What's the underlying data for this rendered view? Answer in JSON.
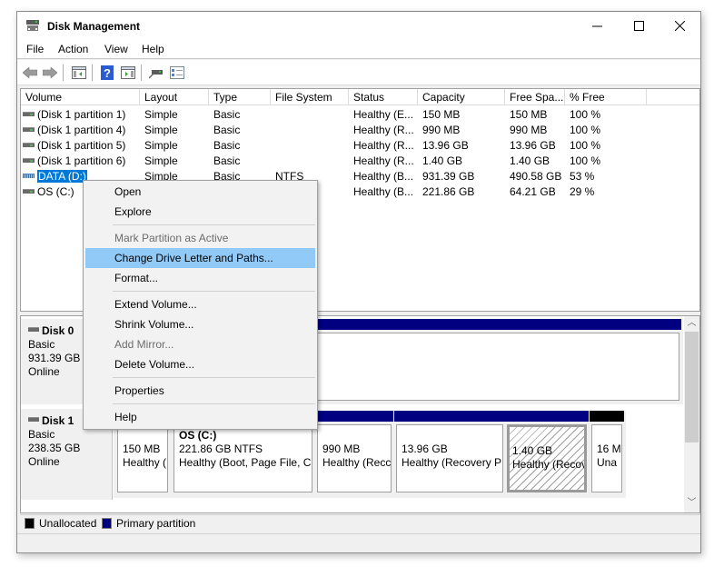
{
  "window": {
    "title": "Disk Management",
    "controls": {
      "minimize": "—",
      "maximize": "☐",
      "close": "✕"
    }
  },
  "menu": [
    "File",
    "Action",
    "View",
    "Help"
  ],
  "toolbar": {
    "buttons": [
      "back-arrow-icon",
      "forward-arrow-icon",
      "show-hide-console-tree-icon",
      "help-icon",
      "show-hide-action-pane-icon",
      "connect-disk-icon",
      "properties-checklist-icon"
    ]
  },
  "volume_list": {
    "columns": [
      "Volume",
      "Layout",
      "Type",
      "File System",
      "Status",
      "Capacity",
      "Free Spa...",
      "% Free"
    ],
    "rows": [
      {
        "volume": "(Disk 1 partition 1)",
        "layout": "Simple",
        "type": "Basic",
        "fs": "",
        "status": "Healthy (E...",
        "capacity": "150 MB",
        "free": "150 MB",
        "pct": "100 %"
      },
      {
        "volume": "(Disk 1 partition 4)",
        "layout": "Simple",
        "type": "Basic",
        "fs": "",
        "status": "Healthy (R...",
        "capacity": "990 MB",
        "free": "990 MB",
        "pct": "100 %"
      },
      {
        "volume": "(Disk 1 partition 5)",
        "layout": "Simple",
        "type": "Basic",
        "fs": "",
        "status": "Healthy (R...",
        "capacity": "13.96 GB",
        "free": "13.96 GB",
        "pct": "100 %"
      },
      {
        "volume": "(Disk 1 partition 6)",
        "layout": "Simple",
        "type": "Basic",
        "fs": "",
        "status": "Healthy (R...",
        "capacity": "1.40 GB",
        "free": "1.40 GB",
        "pct": "100 %"
      },
      {
        "volume": "DATA (D:)",
        "layout": "Simple",
        "type": "Basic",
        "fs": "NTFS",
        "status": "Healthy (B...",
        "capacity": "931.39 GB",
        "free": "490.58 GB",
        "pct": "53 %"
      },
      {
        "volume": "OS (C:)",
        "layout": "",
        "type": "",
        "fs": "",
        "status": "Healthy (B...",
        "capacity": "221.86 GB",
        "free": "64.21 GB",
        "pct": "29 %"
      }
    ],
    "selected_row": 4
  },
  "context_menu": {
    "items": [
      {
        "label": "Open",
        "enabled": true
      },
      {
        "label": "Explore",
        "enabled": true
      },
      {
        "label": "Mark Partition as Active",
        "enabled": false
      },
      {
        "label": "Change Drive Letter and Paths...",
        "enabled": true,
        "highlighted": true
      },
      {
        "label": "Format...",
        "enabled": true
      },
      {
        "label": "Extend Volume...",
        "enabled": true
      },
      {
        "label": "Shrink Volume...",
        "enabled": true
      },
      {
        "label": "Add Mirror...",
        "enabled": false
      },
      {
        "label": "Delete Volume...",
        "enabled": true
      },
      {
        "label": "Properties",
        "enabled": true
      },
      {
        "label": "Help",
        "enabled": true
      }
    ]
  },
  "disks": [
    {
      "name": "Disk 0",
      "type": "Basic",
      "size": "931.39 GB",
      "status": "Online"
    },
    {
      "name": "Disk 1",
      "type": "Basic",
      "size": "238.35 GB",
      "status": "Online",
      "partitions": [
        {
          "title": "",
          "line1": "150 MB",
          "line2": "Healthy ("
        },
        {
          "title": "OS  (C:)",
          "line1": "221.86 GB NTFS",
          "line2": "Healthy (Boot, Page File, Cı"
        },
        {
          "title": "",
          "line1": "990 MB",
          "line2": "Healthy (Recc"
        },
        {
          "title": "",
          "line1": "13.96 GB",
          "line2": "Healthy (Recovery P"
        },
        {
          "title": "",
          "line1": "1.40 GB",
          "line2": "Healthy (Recov"
        },
        {
          "title": "",
          "line1": "16 M",
          "line2": "Una"
        }
      ]
    }
  ],
  "legend": [
    {
      "label": "Unallocated",
      "color": "#000000"
    },
    {
      "label": "Primary partition",
      "color": "#000080"
    }
  ],
  "colors": {
    "primary_partition": "#000080",
    "unallocated": "#000000",
    "selection": "#0078d7",
    "menu_highlight": "#91c9f7"
  }
}
